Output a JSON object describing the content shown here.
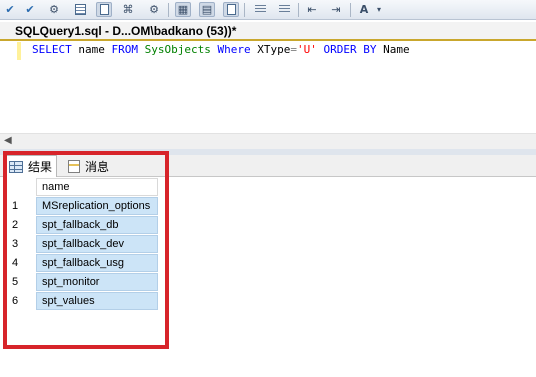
{
  "toolbar": {
    "buttons": [
      {
        "icon": "check-icon",
        "glyph": "✔"
      },
      {
        "icon": "check-doc-icon",
        "glyph": "✔"
      },
      {
        "icon": "debug-icon",
        "glyph": "⚙"
      },
      {
        "icon": "results-to-grid-icon",
        "glyph": ""
      },
      {
        "icon": "results-to-file-icon",
        "glyph": ""
      },
      {
        "icon": "display-plan-icon",
        "glyph": "⌘"
      },
      {
        "icon": "query-options-icon",
        "glyph": "⚙"
      },
      {
        "icon": "results-grid-icon",
        "glyph": "▦"
      },
      {
        "icon": "results-text-icon",
        "glyph": "▤"
      },
      {
        "icon": "comment-icon",
        "glyph": "≡"
      },
      {
        "icon": "uncomment-icon",
        "glyph": "≡"
      },
      {
        "icon": "outdent-icon",
        "glyph": "⇤"
      },
      {
        "icon": "indent-icon",
        "glyph": "⇥"
      },
      {
        "icon": "specify-values-icon",
        "glyph": "A"
      }
    ]
  },
  "editor": {
    "tab_title": "SQLQuery1.sql - D...OM\\badkano (53))*",
    "query_tokens": [
      {
        "text": "SELECT",
        "kind": "kw"
      },
      {
        "text": " name ",
        "kind": "plain"
      },
      {
        "text": "FROM",
        "kind": "kw"
      },
      {
        "text": " ",
        "kind": "plain"
      },
      {
        "text": "SysObjects",
        "kind": "obj"
      },
      {
        "text": " ",
        "kind": "plain"
      },
      {
        "text": "Where",
        "kind": "kw"
      },
      {
        "text": " XType",
        "kind": "plain"
      },
      {
        "text": "=",
        "kind": "gray"
      },
      {
        "text": "'U'",
        "kind": "str"
      },
      {
        "text": " ",
        "kind": "plain"
      },
      {
        "text": "ORDER BY",
        "kind": "kw"
      },
      {
        "text": " Name",
        "kind": "plain"
      }
    ]
  },
  "results": {
    "tabs": [
      {
        "label": "结果",
        "icon": "grid-icon"
      },
      {
        "label": "消息",
        "icon": "messages-icon"
      }
    ],
    "column_header": "name",
    "rows": [
      {
        "num": "1",
        "name": "MSreplication_options"
      },
      {
        "num": "2",
        "name": "spt_fallback_db"
      },
      {
        "num": "3",
        "name": "spt_fallback_dev"
      },
      {
        "num": "4",
        "name": "spt_fallback_usg"
      },
      {
        "num": "5",
        "name": "spt_monitor"
      },
      {
        "num": "6",
        "name": "spt_values"
      }
    ]
  },
  "colors": {
    "highlight_border": "#d7242a",
    "cell_selected": "#cce4f7",
    "keyword": "#0000ff",
    "object": "#008000",
    "string": "#ff0000"
  }
}
